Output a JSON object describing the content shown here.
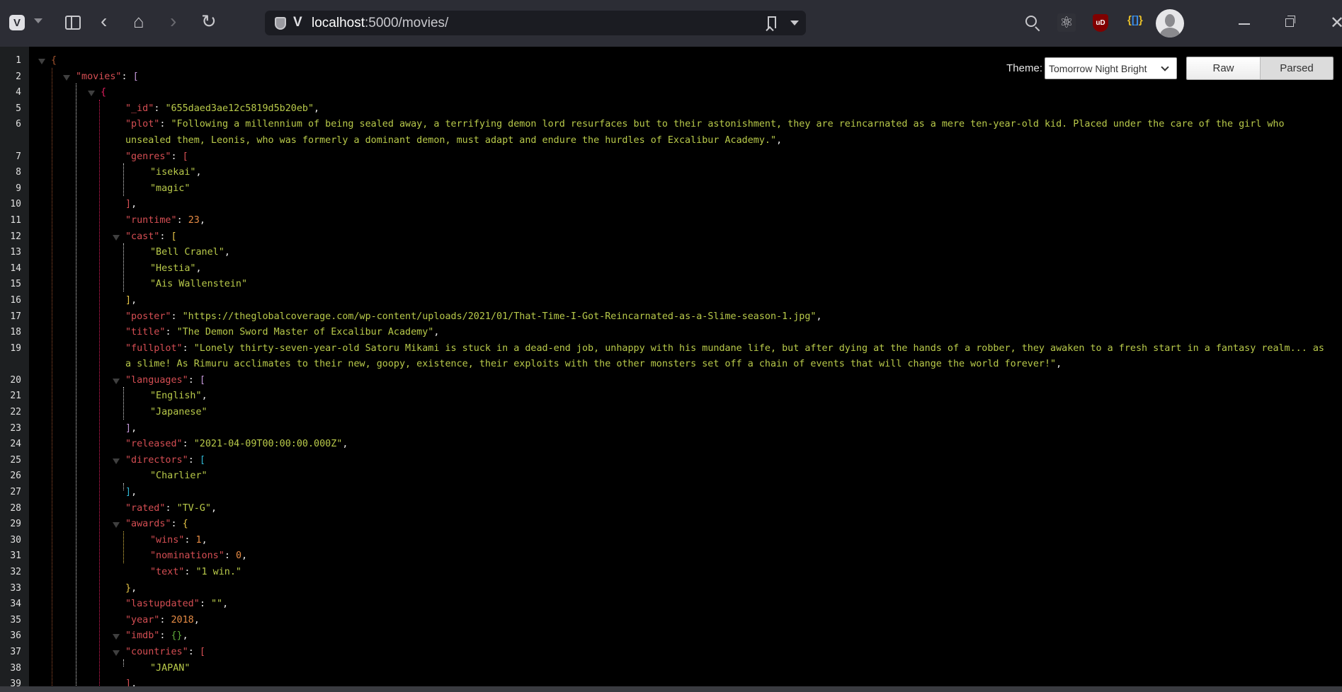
{
  "browser": {
    "url_host": "localhost",
    "url_rest": ":5000/movies/",
    "icons": [
      "vivaldi-logo",
      "vivaldi-menu",
      "panel-toggle",
      "back",
      "home",
      "forward",
      "reload",
      "site-shield",
      "bookmark",
      "url-dropdown",
      "search",
      "react-devtools",
      "ublock-origin",
      "json-viewer",
      "profile-avatar",
      "minimize",
      "maximize",
      "close"
    ],
    "ublock_label": "uD",
    "react_glyph": "⚛",
    "close_glyph": "✕"
  },
  "controls": {
    "theme_label": "Theme:",
    "theme_value": "Tomorrow Night Bright",
    "raw_label": "Raw",
    "parsed_label": "Parsed",
    "active_mode": "Parsed"
  },
  "colors": {
    "key": "#d54e53",
    "string": "#b9ca4a",
    "number": "#e78c45",
    "punct": "#eaeaea",
    "bracket_level1": "#a5552f",
    "bracket_level2": "#c397d8",
    "bracket_level3": "#e31e5f",
    "bracket_yellow": "#e7c547",
    "bracket_cyan": "#2fb7d4",
    "bracket_green": "#5faa3a"
  },
  "json_lines": [
    {
      "n": "1",
      "tokens": [
        {
          "t": "{",
          "c": "#a5552f"
        }
      ]
    },
    {
      "n": "2",
      "tokens": [
        {
          "t": "\"movies\"",
          "c": "k"
        },
        {
          "t": ": ",
          "c": "p"
        },
        {
          "t": "[",
          "c": "#c397d8"
        }
      ]
    },
    {
      "n": "4",
      "tokens": [
        {
          "t": "{",
          "c": "#e31e5f"
        }
      ]
    },
    {
      "n": "5",
      "tokens": [
        {
          "t": "\"_id\"",
          "c": "k"
        },
        {
          "t": ": ",
          "c": "p"
        },
        {
          "t": "\"655daed3ae12c5819d5b20eb\"",
          "c": "s"
        },
        {
          "t": ",",
          "c": "p"
        }
      ]
    },
    {
      "n": "6",
      "tokens": [
        {
          "t": "\"plot\"",
          "c": "k"
        },
        {
          "t": ": ",
          "c": "p"
        },
        {
          "t": "\"Following a millennium of being sealed away, a terrifying demon lord resurfaces but to their astonishment, they are reincarnated as a mere ten-year-old kid. Placed under the care of the girl who unsealed them, Leonis, who was formerly a dominant demon, must adapt and endure the hurdles of Excalibur Academy.\"",
          "c": "s"
        },
        {
          "t": ",",
          "c": "p"
        }
      ]
    },
    {
      "n": "7",
      "tokens": [
        {
          "t": "\"genres\"",
          "c": "k"
        },
        {
          "t": ": ",
          "c": "p"
        },
        {
          "t": "[",
          "c": "#d54e53"
        }
      ]
    },
    {
      "n": "8",
      "tokens": [
        {
          "t": "\"isekai\"",
          "c": "s"
        },
        {
          "t": ",",
          "c": "p"
        }
      ]
    },
    {
      "n": "9",
      "tokens": [
        {
          "t": "\"magic\"",
          "c": "s"
        }
      ]
    },
    {
      "n": "10",
      "tokens": [
        {
          "t": "]",
          "c": "#d54e53"
        },
        {
          "t": ",",
          "c": "p"
        }
      ]
    },
    {
      "n": "11",
      "tokens": [
        {
          "t": "\"runtime\"",
          "c": "k"
        },
        {
          "t": ": ",
          "c": "p"
        },
        {
          "t": "23",
          "c": "n"
        },
        {
          "t": ",",
          "c": "p"
        }
      ]
    },
    {
      "n": "12",
      "tokens": [
        {
          "t": "\"cast\"",
          "c": "k"
        },
        {
          "t": ": ",
          "c": "p"
        },
        {
          "t": "[",
          "c": "#e7c547"
        }
      ]
    },
    {
      "n": "13",
      "tokens": [
        {
          "t": "\"Bell Cranel\"",
          "c": "s"
        },
        {
          "t": ",",
          "c": "p"
        }
      ]
    },
    {
      "n": "14",
      "tokens": [
        {
          "t": "\"Hestia\"",
          "c": "s"
        },
        {
          "t": ",",
          "c": "p"
        }
      ]
    },
    {
      "n": "15",
      "tokens": [
        {
          "t": "\"Ais Wallenstein\"",
          "c": "s"
        }
      ]
    },
    {
      "n": "16",
      "tokens": [
        {
          "t": "]",
          "c": "#e7c547"
        },
        {
          "t": ",",
          "c": "p"
        }
      ]
    },
    {
      "n": "17",
      "tokens": [
        {
          "t": "\"poster\"",
          "c": "k"
        },
        {
          "t": ": ",
          "c": "p"
        },
        {
          "t": "\"https://theglobalcoverage.com/wp-content/uploads/2021/01/That-Time-I-Got-Reincarnated-as-a-Slime-season-1.jpg\"",
          "c": "s"
        },
        {
          "t": ",",
          "c": "p"
        }
      ]
    },
    {
      "n": "18",
      "tokens": [
        {
          "t": "\"title\"",
          "c": "k"
        },
        {
          "t": ": ",
          "c": "p"
        },
        {
          "t": "\"The Demon Sword Master of Excalibur Academy\"",
          "c": "s"
        },
        {
          "t": ",",
          "c": "p"
        }
      ]
    },
    {
      "n": "19",
      "tokens": [
        {
          "t": "\"fullplot\"",
          "c": "k"
        },
        {
          "t": ": ",
          "c": "p"
        },
        {
          "t": "\"Lonely thirty-seven-year-old Satoru Mikami is stuck in a dead-end job, unhappy with his mundane life, but after dying at the hands of a robber, they awaken to a fresh start in a fantasy realm... as a slime! As Rimuru acclimates to their new, goopy, existence, their exploits with the other monsters set off a chain of events that will change the world forever!\"",
          "c": "s"
        },
        {
          "t": ",",
          "c": "p"
        }
      ]
    },
    {
      "n": "20",
      "tokens": [
        {
          "t": "\"languages\"",
          "c": "k"
        },
        {
          "t": ": ",
          "c": "p"
        },
        {
          "t": "[",
          "c": "#c397d8"
        }
      ]
    },
    {
      "n": "21",
      "tokens": [
        {
          "t": "\"English\"",
          "c": "s"
        },
        {
          "t": ",",
          "c": "p"
        }
      ]
    },
    {
      "n": "22",
      "tokens": [
        {
          "t": "\"Japanese\"",
          "c": "s"
        }
      ]
    },
    {
      "n": "23",
      "tokens": [
        {
          "t": "]",
          "c": "#c397d8"
        },
        {
          "t": ",",
          "c": "p"
        }
      ]
    },
    {
      "n": "24",
      "tokens": [
        {
          "t": "\"released\"",
          "c": "k"
        },
        {
          "t": ": ",
          "c": "p"
        },
        {
          "t": "\"2021-04-09T00:00:00.000Z\"",
          "c": "s"
        },
        {
          "t": ",",
          "c": "p"
        }
      ]
    },
    {
      "n": "25",
      "tokens": [
        {
          "t": "\"directors\"",
          "c": "k"
        },
        {
          "t": ": ",
          "c": "p"
        },
        {
          "t": "[",
          "c": "#2fb7d4"
        }
      ]
    },
    {
      "n": "26",
      "tokens": [
        {
          "t": "\"Charlier\"",
          "c": "s"
        }
      ]
    },
    {
      "n": "27",
      "tokens": [
        {
          "t": "]",
          "c": "#2fb7d4"
        },
        {
          "t": ",",
          "c": "p"
        }
      ]
    },
    {
      "n": "28",
      "tokens": [
        {
          "t": "\"rated\"",
          "c": "k"
        },
        {
          "t": ": ",
          "c": "p"
        },
        {
          "t": "\"TV-G\"",
          "c": "s"
        },
        {
          "t": ",",
          "c": "p"
        }
      ]
    },
    {
      "n": "29",
      "tokens": [
        {
          "t": "\"awards\"",
          "c": "k"
        },
        {
          "t": ": ",
          "c": "p"
        },
        {
          "t": "{",
          "c": "#e7c547"
        }
      ]
    },
    {
      "n": "30",
      "tokens": [
        {
          "t": "\"wins\"",
          "c": "k"
        },
        {
          "t": ": ",
          "c": "p"
        },
        {
          "t": "1",
          "c": "n"
        },
        {
          "t": ",",
          "c": "p"
        }
      ]
    },
    {
      "n": "31",
      "tokens": [
        {
          "t": "\"nominations\"",
          "c": "k"
        },
        {
          "t": ": ",
          "c": "p"
        },
        {
          "t": "0",
          "c": "n"
        },
        {
          "t": ",",
          "c": "p"
        }
      ]
    },
    {
      "n": "32",
      "tokens": [
        {
          "t": "\"text\"",
          "c": "k"
        },
        {
          "t": ": ",
          "c": "p"
        },
        {
          "t": "\"1 win.\"",
          "c": "s"
        }
      ]
    },
    {
      "n": "33",
      "tokens": [
        {
          "t": "}",
          "c": "#e7c547"
        },
        {
          "t": ",",
          "c": "p"
        }
      ]
    },
    {
      "n": "34",
      "tokens": [
        {
          "t": "\"lastupdated\"",
          "c": "k"
        },
        {
          "t": ": ",
          "c": "p"
        },
        {
          "t": "\"\"",
          "c": "s"
        },
        {
          "t": ",",
          "c": "p"
        }
      ]
    },
    {
      "n": "35",
      "tokens": [
        {
          "t": "\"year\"",
          "c": "k"
        },
        {
          "t": ": ",
          "c": "p"
        },
        {
          "t": "2018",
          "c": "n"
        },
        {
          "t": ",",
          "c": "p"
        }
      ]
    },
    {
      "n": "36",
      "tokens": [
        {
          "t": "\"imdb\"",
          "c": "k"
        },
        {
          "t": ": ",
          "c": "p"
        },
        {
          "t": "{}",
          "c": "#5faa3a"
        },
        {
          "t": ",",
          "c": "p"
        }
      ]
    },
    {
      "n": "37",
      "tokens": [
        {
          "t": "\"countries\"",
          "c": "k"
        },
        {
          "t": ": ",
          "c": "p"
        },
        {
          "t": "[",
          "c": "#d54e53"
        }
      ]
    },
    {
      "n": "38",
      "tokens": [
        {
          "t": "\"JAPAN\"",
          "c": "s"
        }
      ]
    },
    {
      "n": "39",
      "tokens": [
        {
          "t": "]",
          "c": "#d54e53"
        },
        {
          "t": ",",
          "c": "p"
        }
      ]
    }
  ]
}
